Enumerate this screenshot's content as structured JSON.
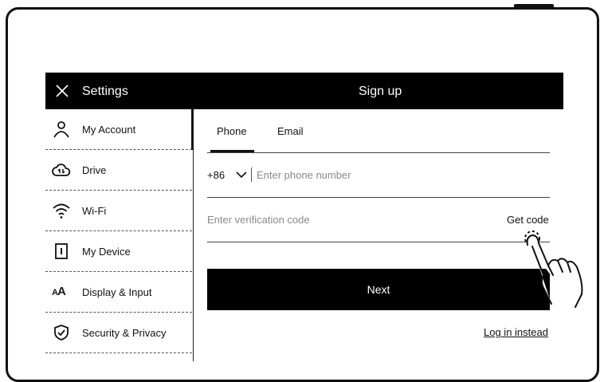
{
  "header": {
    "settings_title": "Settings",
    "page_title": "Sign up"
  },
  "sidebar": {
    "items": [
      {
        "label": "My Account",
        "icon": "person-icon",
        "active": true
      },
      {
        "label": "Drive",
        "icon": "cloud-sync-icon"
      },
      {
        "label": "Wi-Fi",
        "icon": "wifi-icon"
      },
      {
        "label": "My Device",
        "icon": "device-icon"
      },
      {
        "label": "Display & Input",
        "icon": "font-size-icon"
      },
      {
        "label": "Security & Privacy",
        "icon": "shield-check-icon"
      }
    ]
  },
  "form": {
    "tabs": [
      {
        "label": "Phone",
        "active": true
      },
      {
        "label": "Email"
      }
    ],
    "country_code": "+86",
    "phone_placeholder": "Enter phone number",
    "code_placeholder": "Enter verification code",
    "get_code_label": "Get code",
    "next_label": "Next",
    "login_label": "Log in instead"
  }
}
